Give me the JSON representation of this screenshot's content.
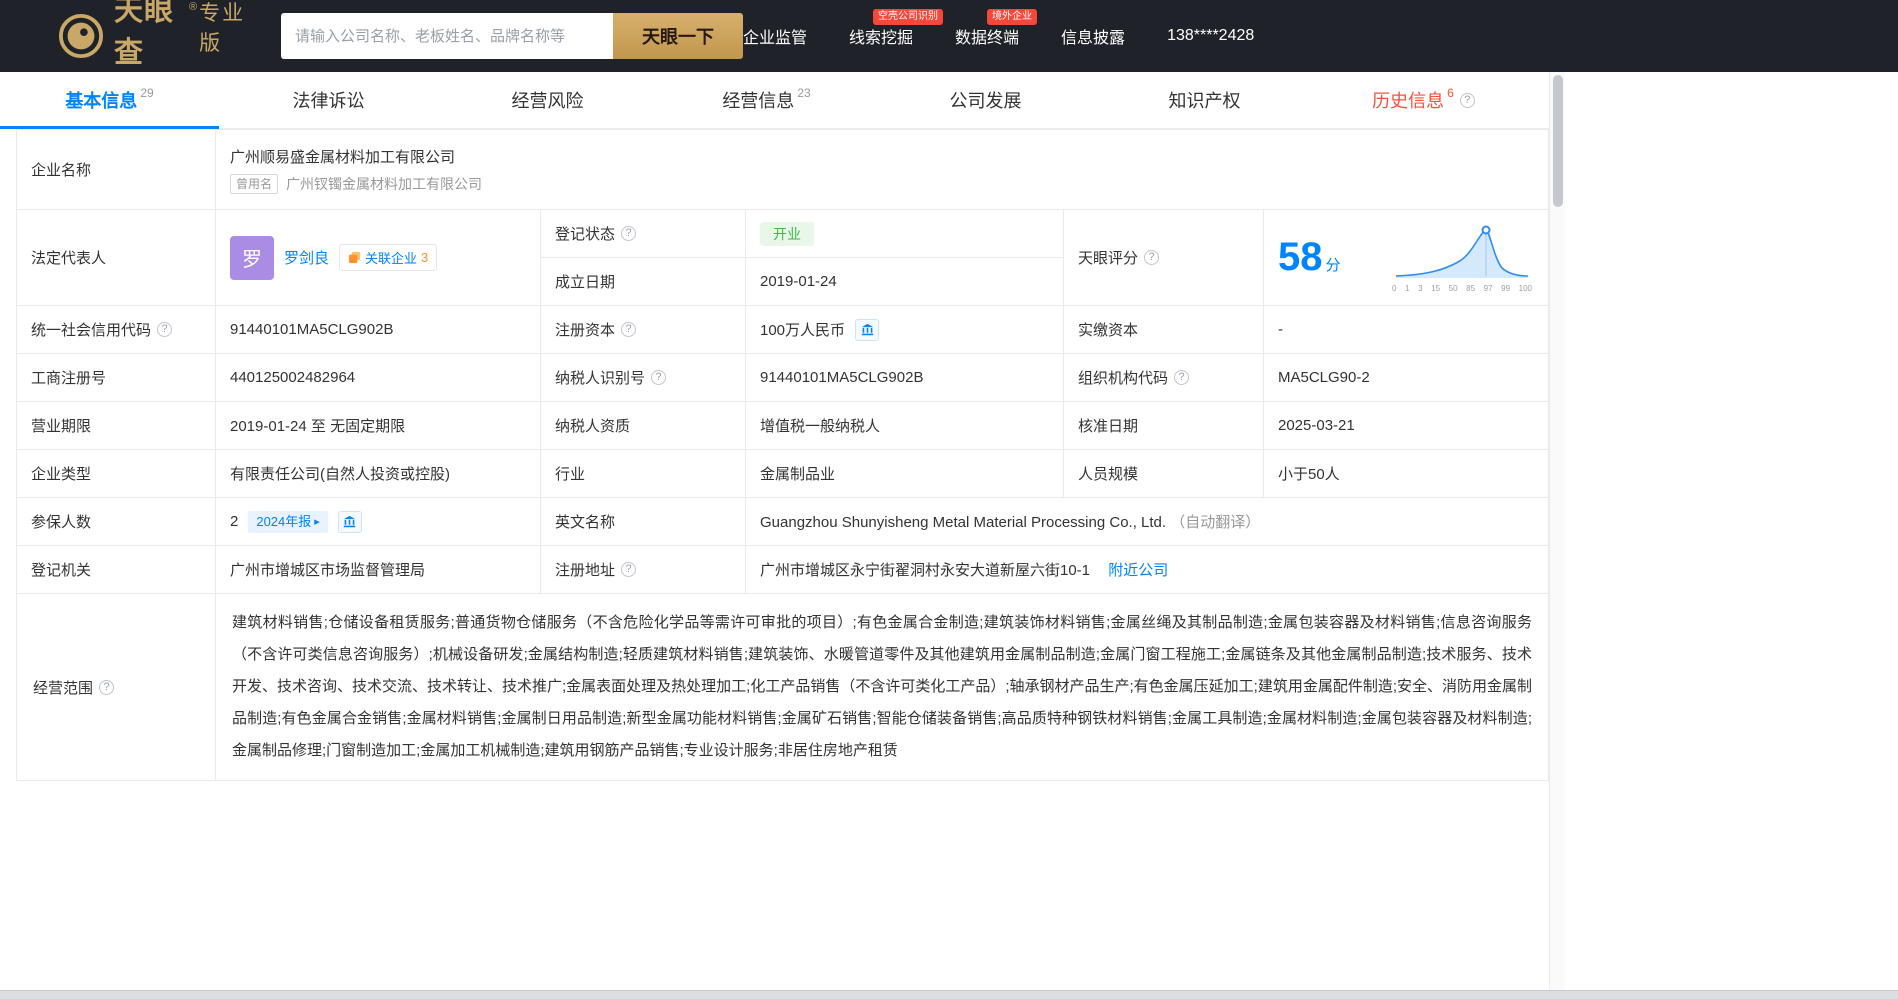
{
  "header": {
    "brand": "天眼查",
    "reg_mark": "®",
    "edition": "专业版",
    "domain": "pro.tianyancha.com",
    "search_placeholder": "请输入公司名称、老板姓名、品牌名称等",
    "search_button": "天眼一下",
    "nav": [
      {
        "label": "企业监管"
      },
      {
        "label": "线索挖掘",
        "badge": "空壳公司识别"
      },
      {
        "label": "数据终端",
        "badge": "境外企业"
      },
      {
        "label": "信息披露"
      }
    ],
    "phone": "138****2428"
  },
  "tabs": [
    {
      "label": "基本信息",
      "count": "29"
    },
    {
      "label": "法律诉讼",
      "count": ""
    },
    {
      "label": "经营风险",
      "count": ""
    },
    {
      "label": "经营信息",
      "count": "23"
    },
    {
      "label": "公司发展",
      "count": ""
    },
    {
      "label": "知识产权",
      "count": ""
    },
    {
      "label": "历史信息",
      "count": "6"
    }
  ],
  "icons": {
    "help": "?",
    "arrow": "▸"
  },
  "basic": {
    "company_name_label": "企业名称",
    "company_name": "广州顺易盛金属材料加工有限公司",
    "former_name_tag": "曾用名",
    "former_name": "广州钗镯金属材料加工有限公司",
    "legal_rep_label": "法定代表人",
    "legal_rep_avatar": "罗",
    "legal_rep_name": "罗剑良",
    "related_companies_label": "关联企业",
    "related_companies_count": "3",
    "reg_status_label": "登记状态",
    "reg_status": "开业",
    "est_date_label": "成立日期",
    "est_date": "2019-01-24",
    "score_label": "天眼评分",
    "score_value": "58",
    "score_unit": "分",
    "score_axis": [
      "0",
      "1",
      "3",
      "15",
      "50",
      "85",
      "97",
      "99",
      "100"
    ],
    "credit_code_label": "统一社会信用代码",
    "credit_code": "91440101MA5CLG902B",
    "reg_capital_label": "注册资本",
    "reg_capital": "100万人民币",
    "paid_capital_label": "实缴资本",
    "paid_capital": "-",
    "reg_number_label": "工商注册号",
    "reg_number": "440125002482964",
    "taxpayer_id_label": "纳税人识别号",
    "taxpayer_id": "91440101MA5CLG902B",
    "org_code_label": "组织机构代码",
    "org_code": "MA5CLG90-2",
    "business_term_label": "营业期限",
    "business_term": "2019-01-24 至 无固定期限",
    "taxpayer_quality_label": "纳税人资质",
    "taxpayer_quality": "增值税一般纳税人",
    "approval_date_label": "核准日期",
    "approval_date": "2025-03-21",
    "company_type_label": "企业类型",
    "company_type": "有限责任公司(自然人投资或控股)",
    "industry_label": "行业",
    "industry": "金属制品业",
    "staff_size_label": "人员规模",
    "staff_size": "小于50人",
    "insured_label": "参保人数",
    "insured_count": "2",
    "annual_report_badge": "2024年报",
    "english_name_label": "英文名称",
    "english_name": "Guangzhou Shunyisheng Metal Material Processing Co., Ltd.",
    "english_name_note": "（自动翻译）",
    "reg_authority_label": "登记机关",
    "reg_authority": "广州市增城区市场监督管理局",
    "reg_address_label": "注册地址",
    "reg_address": "广州市增城区永宁街翟洞村永安大道新屋六街10-1",
    "nearby_link": "附近公司",
    "business_scope_label": "经营范围",
    "business_scope": "建筑材料销售;仓储设备租赁服务;普通货物仓储服务（不含危险化学品等需许可审批的项目）;有色金属合金制造;建筑装饰材料销售;金属丝绳及其制品制造;金属包装容器及材料销售;信息咨询服务（不含许可类信息咨询服务）;机械设备研发;金属结构制造;轻质建筑材料销售;建筑装饰、水暖管道零件及其他建筑用金属制品制造;金属门窗工程施工;金属链条及其他金属制品制造;技术服务、技术开发、技术咨询、技术交流、技术转让、技术推广;金属表面处理及热处理加工;化工产品销售（不含许可类化工产品）;轴承钢材产品生产;有色金属压延加工;建筑用金属配件制造;安全、消防用金属制品制造;有色金属合金销售;金属材料销售;金属制日用品制造;新型金属功能材料销售;金属矿石销售;智能仓储装备销售;高品质特种钢铁材料销售;金属工具制造;金属材料制造;金属包装容器及材料制造;金属制品修理;门窗制造加工;金属加工机械制造;建筑用钢筋产品销售;专业设计服务;非居住房地产租赁"
  },
  "colors": {
    "accent_blue": "#0084ff",
    "brand_gold": "#c9a767",
    "status_green": "#3eb944",
    "alert_red": "#f5483b",
    "history_red": "#ff4f3b"
  }
}
